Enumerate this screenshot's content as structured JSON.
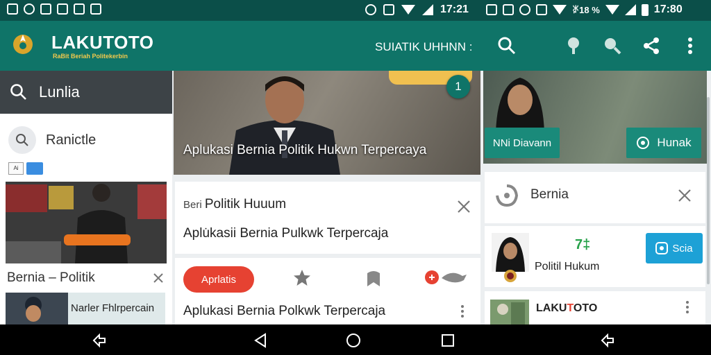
{
  "status_bar": {
    "time_center": "17:21",
    "time_right": "17:80",
    "indicator_text": "ꑊ18 %"
  },
  "app_bar": {
    "logo": "LAKUTOTO",
    "logo_tagline": "RaBit Beriah Politekerbin",
    "section_label": "SUIATIK UHHNN :"
  },
  "left_panel": {
    "search_label": "Lunlia",
    "suggestion_label": "Ranictle",
    "chip_label": "Ai",
    "card_title": "Bernia – Politik",
    "card2_text": "Narler Fhlrpercain"
  },
  "center_panel": {
    "hero_badge": "1",
    "hero_caption": "Aplukasi Bernia Politik Hukwn Terpercaya",
    "card1_kicker": "Beri",
    "card1_heading": "Politik Huuum",
    "card1_body": "Aplu̇kasii Bernia Pulkwk Terpercaja",
    "pill_label": "Aprlatis",
    "card2_body": "Aplukasi Bernia Polkwk Terpercaja"
  },
  "right_panel": {
    "btn_left": "NNi Diavann",
    "btn_right": "Hunak",
    "card1_title": "Bernia",
    "card2_number": "7‡",
    "card2_title": "Politil Hukum",
    "cta_label": "Scia",
    "card3_title_prefix": "LAKU",
    "card3_title_mid": "T",
    "card3_title_suffix": "OTO"
  },
  "colors": {
    "primary": "#0f7468",
    "status_bar": "#0b4f49",
    "accent_gold": "#f2c94c",
    "pill_red": "#e64232",
    "cta_blue": "#1da1d6"
  }
}
